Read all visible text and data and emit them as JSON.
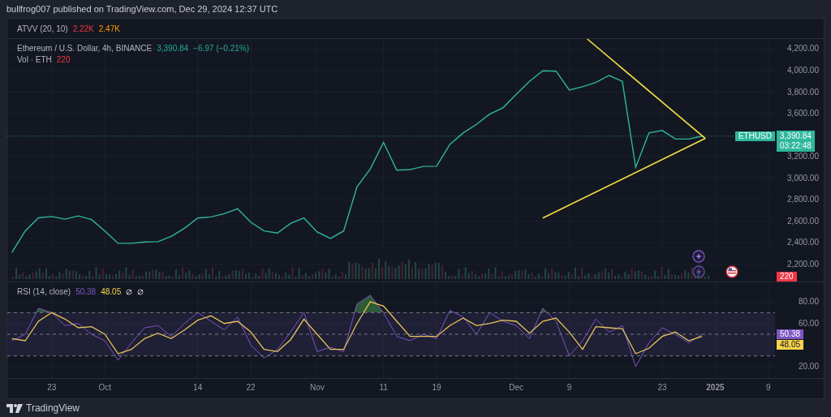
{
  "header": {
    "text": "bullfrog007 published on TradingView.com, Dec 29, 2024 12:37 UTC"
  },
  "indicator_legend": {
    "name": "ATVV (20, 10)",
    "values": [
      "2.22K",
      "2.47K"
    ]
  },
  "main_pane": {
    "legend": {
      "symbol": "Ethereum / U.S. Dollar, 4h, BINANCE",
      "price": "3,390.84",
      "change": "−6.97 (−0.21%)",
      "volume_label": "Vol · ETH",
      "volume_value": "220"
    },
    "chart_data": {
      "type": "line",
      "ylim": [
        2040,
        4294
      ],
      "grid": true,
      "yticks": [
        {
          "value": 2200,
          "label": "2,200.00"
        },
        {
          "value": 2400,
          "label": "2,400.00"
        },
        {
          "value": 2600,
          "label": "2,600.00"
        },
        {
          "value": 2800,
          "label": "2,800.00"
        },
        {
          "value": 3000,
          "label": "3,000.00"
        },
        {
          "value": 3200,
          "label": "3,200.00"
        },
        {
          "value": 3600,
          "label": "3,600.00"
        },
        {
          "value": 3800,
          "label": "3,800.00"
        },
        {
          "value": 4000,
          "label": "4,000.00"
        },
        {
          "value": 4200,
          "label": "4,200.00"
        }
      ],
      "categories": [
        null,
        null,
        null,
        null,
        null,
        null,
        null,
        null,
        null,
        null,
        null,
        null,
        null,
        null,
        null,
        null,
        null,
        null,
        null,
        null,
        null,
        null,
        null,
        null,
        null,
        null,
        null,
        null,
        null,
        null,
        null,
        null,
        null,
        null,
        null,
        null,
        null,
        null,
        null,
        null,
        null,
        null,
        null,
        null,
        null,
        null,
        null,
        null,
        null,
        null,
        null,
        null,
        null,
        null,
        null,
        null,
        null,
        null
      ],
      "series": [
        {
          "name": "ETHUSD",
          "color": "#2fb79b",
          "values": [
            2310,
            2510,
            2632,
            2644,
            2620,
            2650,
            2616,
            2510,
            2395,
            2395,
            2407,
            2410,
            2460,
            2535,
            2630,
            2640,
            2670,
            2716,
            2590,
            2510,
            2490,
            2580,
            2630,
            2500,
            2440,
            2510,
            2920,
            3085,
            3333,
            3074,
            3080,
            3110,
            3111,
            3315,
            3420,
            3500,
            3596,
            3655,
            3780,
            3900,
            3998,
            3995,
            3820,
            3850,
            3889,
            3955,
            3900,
            3100,
            3420,
            3444,
            3364,
            3364,
            3391,
            null,
            null,
            null,
            null,
            null
          ]
        }
      ]
    },
    "price_tag": "3,390.84",
    "countdown": "03:22:48",
    "volume_tag": "220"
  },
  "rsi_pane": {
    "legend": {
      "name": "RSI (14, close)",
      "values": [
        {
          "text": "50.38",
          "color": "#7e57c2"
        },
        {
          "text": "48.05",
          "color": "#f7d34a"
        }
      ]
    },
    "chart_data": {
      "type": "line",
      "ylim": [
        9.5,
        98
      ],
      "grid": true,
      "yticks": [
        {
          "value": 20,
          "label": "20.00"
        },
        {
          "value": 60,
          "label": "60.00"
        },
        {
          "value": 80,
          "label": "80.00"
        }
      ],
      "categories": [
        null,
        null,
        null,
        "23",
        null,
        null,
        null,
        "Oct",
        null,
        null,
        null,
        null,
        null,
        null,
        "14",
        null,
        null,
        null,
        "22",
        null,
        null,
        null,
        null,
        "Nov",
        null,
        null,
        null,
        null,
        "11",
        null,
        null,
        null,
        "19",
        null,
        null,
        null,
        null,
        null,
        "Dec",
        null,
        null,
        null,
        "9",
        null,
        null,
        null,
        null,
        null,
        null,
        "23",
        null,
        null,
        null,
        "2025",
        null,
        null,
        null,
        "9"
      ],
      "series": [
        {
          "color": "#7e57c2",
          "values": [
            44,
            50,
            74,
            70,
            58,
            60,
            50,
            44,
            26,
            42,
            56,
            58,
            48,
            60,
            70,
            62,
            54,
            66,
            40,
            28,
            36,
            52,
            70,
            34,
            38,
            34,
            78,
            86,
            70,
            48,
            44,
            50,
            46,
            72,
            66,
            50,
            70,
            62,
            58,
            46,
            74,
            62,
            30,
            44,
            64,
            52,
            58,
            20,
            42,
            56,
            50,
            42,
            50,
            null,
            null,
            null,
            null,
            null
          ]
        },
        {
          "color": "#f7d34a",
          "values": [
            46,
            44,
            62,
            70,
            64,
            56,
            57,
            50,
            32,
            36,
            46,
            51,
            46,
            54,
            63,
            67,
            60,
            62,
            52,
            36,
            34,
            45,
            64,
            50,
            36,
            36,
            60,
            80,
            76,
            62,
            48,
            48,
            48,
            58,
            65,
            58,
            60,
            63,
            62,
            51,
            62,
            65,
            52,
            36,
            57,
            56,
            55,
            32,
            37,
            48,
            52,
            44,
            48,
            null,
            null,
            null,
            null,
            null
          ]
        }
      ]
    },
    "tags": [
      {
        "text": "50.38",
        "color": "#7e57c2"
      },
      {
        "text": "48.05",
        "color": "#f7d34a"
      }
    ]
  },
  "footer": {
    "brand": "TradingView"
  }
}
